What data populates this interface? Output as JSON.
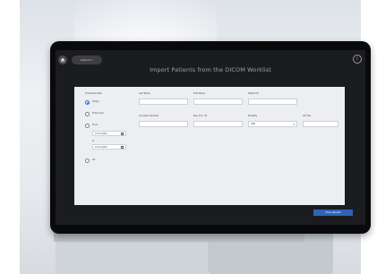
{
  "topbar": {
    "patient_label": "Patient 1",
    "info_label": "i"
  },
  "title": "Import Patients from the DICOM Worklist",
  "filters": {
    "scheduled_date_label": "Scheduled date",
    "options": [
      {
        "label": "Today",
        "checked": true
      },
      {
        "label": "Tomorrow",
        "checked": false
      },
      {
        "label": "From",
        "checked": false
      },
      {
        "label": "All",
        "checked": false
      }
    ],
    "from_date": "21.01.2024",
    "to_label": "to",
    "to_date": "21.01.2024"
  },
  "fields": {
    "last_name": {
      "label": "Last Name",
      "value": ""
    },
    "first_name": {
      "label": "First Name",
      "value": ""
    },
    "patient_id": {
      "label": "Patient ID",
      "value": ""
    },
    "accession_number": {
      "label": "Accession Number",
      "value": ""
    },
    "req_proc_id": {
      "label": "Req. Proc. ID",
      "value": ""
    },
    "modality": {
      "label": "Modality",
      "value": "ANY"
    },
    "ae_title": {
      "label": "AE Title",
      "value": ""
    }
  },
  "actions": {
    "show_results": "Show Results"
  },
  "colors": {
    "primary_button": "#2f63b8",
    "selected_radio": "#2e6fd1",
    "screen_background": "#1b1c20",
    "panel_background": "#eceef1"
  },
  "icons": {
    "home": "home-icon",
    "info": "info-icon",
    "calendar": "calendar-icon",
    "dropdown": "chevron-down-icon"
  }
}
